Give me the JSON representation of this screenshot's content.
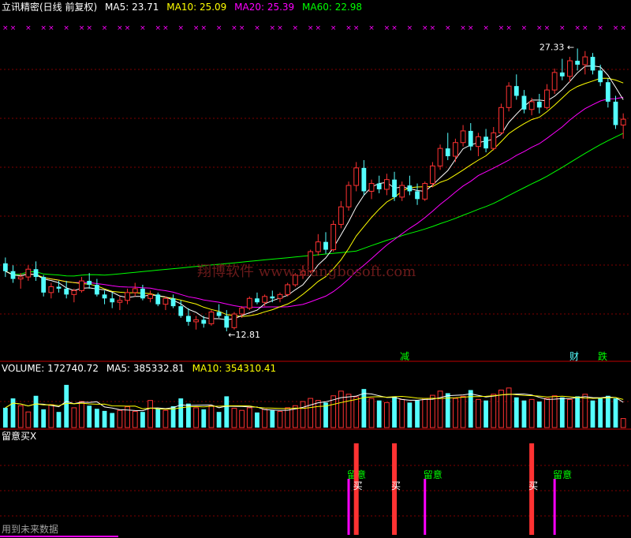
{
  "colors": {
    "background": "#000000",
    "up": "#ff3232",
    "down": "#54ffff",
    "ma5": "#ffffff",
    "ma10": "#ffff00",
    "ma20": "#ff00ff",
    "ma60": "#00ff00",
    "grid": "#800000",
    "marker": "#ff00ff"
  },
  "main_header": {
    "title": "立讯精密(日线 前复权)",
    "ma5": "MA5: 23.71",
    "ma10": "MA10: 25.09",
    "ma20": "MA20: 25.39",
    "ma60": "MA60: 22.98"
  },
  "volume_header": {
    "volume": "VOLUME: 172740.72",
    "ma5": "MA5: 385332.81",
    "ma10": "MA10: 354310.41"
  },
  "indicator_header": {
    "title": "留意买X"
  },
  "footer_note": "用到未来数据",
  "watermark": "翔博软件 www.xiangbosoft.com",
  "tags": {
    "jian": "减",
    "cai": "财",
    "die": "跌"
  },
  "signal_labels": {
    "watch": "留意",
    "buy": "买"
  },
  "chart_data": [
    {
      "type": "candlestick",
      "title": "立讯精密(日线 前复权)",
      "annotations": [
        {
          "text": "27.33",
          "kind": "high"
        },
        {
          "text": "12.81",
          "kind": "low"
        }
      ],
      "ohlc": [
        [
          16.3,
          16.6,
          15.6,
          15.9
        ],
        [
          15.9,
          16.2,
          15.3,
          15.5
        ],
        [
          15.5,
          15.8,
          15.0,
          15.6
        ],
        [
          15.6,
          16.2,
          15.4,
          16.0
        ],
        [
          16.0,
          16.4,
          15.4,
          15.6
        ],
        [
          15.6,
          15.7,
          14.6,
          14.8
        ],
        [
          14.8,
          15.3,
          14.5,
          15.1
        ],
        [
          15.1,
          15.4,
          14.8,
          15.0
        ],
        [
          15.0,
          15.4,
          14.5,
          14.7
        ],
        [
          14.7,
          15.0,
          14.3,
          14.9
        ],
        [
          14.9,
          15.6,
          14.8,
          15.4
        ],
        [
          15.4,
          15.8,
          15.0,
          15.2
        ],
        [
          15.2,
          15.5,
          14.6,
          14.7
        ],
        [
          14.7,
          14.9,
          14.2,
          14.5
        ],
        [
          14.5,
          14.8,
          14.0,
          14.3
        ],
        [
          14.3,
          14.6,
          13.9,
          14.4
        ],
        [
          14.4,
          15.0,
          14.2,
          14.8
        ],
        [
          14.8,
          15.3,
          14.6,
          15.0
        ],
        [
          15.0,
          15.2,
          14.4,
          14.5
        ],
        [
          14.5,
          14.9,
          14.3,
          14.7
        ],
        [
          14.7,
          14.8,
          14.1,
          14.2
        ],
        [
          14.2,
          14.6,
          13.9,
          14.5
        ],
        [
          14.5,
          14.7,
          14.0,
          14.1
        ],
        [
          14.1,
          14.4,
          13.5,
          13.6
        ],
        [
          13.6,
          14.0,
          13.1,
          13.3
        ],
        [
          13.3,
          13.6,
          12.9,
          13.4
        ],
        [
          13.4,
          13.6,
          13.0,
          13.2
        ],
        [
          13.2,
          13.9,
          13.1,
          13.8
        ],
        [
          13.8,
          14.2,
          13.5,
          13.6
        ],
        [
          13.6,
          13.9,
          12.81,
          13.0
        ],
        [
          13.0,
          13.8,
          12.9,
          13.7
        ],
        [
          13.7,
          14.1,
          13.5,
          14.0
        ],
        [
          14.0,
          14.6,
          13.9,
          14.5
        ],
        [
          14.5,
          14.8,
          14.2,
          14.3
        ],
        [
          14.3,
          14.7,
          14.1,
          14.6
        ],
        [
          14.6,
          14.9,
          14.3,
          14.5
        ],
        [
          14.5,
          14.8,
          14.3,
          14.7
        ],
        [
          14.7,
          15.3,
          14.6,
          15.2
        ],
        [
          15.2,
          15.8,
          15.1,
          15.7
        ],
        [
          15.7,
          16.2,
          15.5,
          15.9
        ],
        [
          15.9,
          17.0,
          15.8,
          16.9
        ],
        [
          16.9,
          17.8,
          16.7,
          17.4
        ],
        [
          17.4,
          17.9,
          16.8,
          17.0
        ],
        [
          17.0,
          18.5,
          16.9,
          18.3
        ],
        [
          18.3,
          19.5,
          18.1,
          19.2
        ],
        [
          19.2,
          20.5,
          19.0,
          20.3
        ],
        [
          20.3,
          21.5,
          20.0,
          21.2
        ],
        [
          21.2,
          21.6,
          19.8,
          20.0
        ],
        [
          20.0,
          20.6,
          19.6,
          20.4
        ],
        [
          20.4,
          20.8,
          19.9,
          20.1
        ],
        [
          20.1,
          20.9,
          19.8,
          20.6
        ],
        [
          20.6,
          21.0,
          19.5,
          19.7
        ],
        [
          19.7,
          20.5,
          19.5,
          20.3
        ],
        [
          20.3,
          20.8,
          19.8,
          20.0
        ],
        [
          20.0,
          20.4,
          19.3,
          19.6
        ],
        [
          19.6,
          20.5,
          19.5,
          20.4
        ],
        [
          20.4,
          21.5,
          20.2,
          21.3
        ],
        [
          21.3,
          22.4,
          21.1,
          22.2
        ],
        [
          22.2,
          23.0,
          21.6,
          21.8
        ],
        [
          21.8,
          22.7,
          21.5,
          22.5
        ],
        [
          22.5,
          23.4,
          22.3,
          23.1
        ],
        [
          23.1,
          23.5,
          22.1,
          22.3
        ],
        [
          22.3,
          23.0,
          21.8,
          22.8
        ],
        [
          22.8,
          23.2,
          22.0,
          22.2
        ],
        [
          22.2,
          23.3,
          22.1,
          23.0
        ],
        [
          23.0,
          24.5,
          22.9,
          24.3
        ],
        [
          24.3,
          25.6,
          24.1,
          25.4
        ],
        [
          25.4,
          26.0,
          24.7,
          24.9
        ],
        [
          24.9,
          25.2,
          24.0,
          24.2
        ],
        [
          24.2,
          24.8,
          23.9,
          24.6
        ],
        [
          24.6,
          25.0,
          24.0,
          24.3
        ],
        [
          24.3,
          25.5,
          24.2,
          25.2
        ],
        [
          25.2,
          26.3,
          25.0,
          26.1
        ],
        [
          26.1,
          26.8,
          25.7,
          25.9
        ],
        [
          25.9,
          26.9,
          25.6,
          26.7
        ],
        [
          26.7,
          27.33,
          26.2,
          26.5
        ],
        [
          26.5,
          27.2,
          26.0,
          26.9
        ],
        [
          26.9,
          27.1,
          26.0,
          26.2
        ],
        [
          26.2,
          26.5,
          25.4,
          25.6
        ],
        [
          25.6,
          25.8,
          24.3,
          24.6
        ],
        [
          24.6,
          24.9,
          23.2,
          23.4
        ],
        [
          23.4,
          24.0,
          22.7,
          23.7
        ]
      ],
      "ma60_end": 22.98,
      "ylim": [
        12.0,
        28.2
      ]
    },
    {
      "type": "bar",
      "title": "VOLUME",
      "ylim": [
        0,
        1000000
      ],
      "values": [
        380000,
        560000,
        420000,
        300000,
        610000,
        350000,
        440000,
        300000,
        820000,
        380000,
        500000,
        420000,
        360000,
        320000,
        280000,
        330000,
        400000,
        310000,
        300000,
        520000,
        360000,
        330000,
        410000,
        560000,
        460000,
        380000,
        350000,
        420000,
        300000,
        600000,
        370000,
        330000,
        380000,
        290000,
        350000,
        330000,
        310000,
        380000,
        420000,
        500000,
        560000,
        520000,
        480000,
        610000,
        700000,
        640000,
        590000,
        740000,
        560000,
        520000,
        480000,
        600000,
        540000,
        480000,
        520000,
        560000,
        620000,
        700000,
        660000,
        560000,
        600000,
        720000,
        540000,
        520000,
        640000,
        720000,
        760000,
        580000,
        520000,
        540000,
        500000,
        560000,
        610000,
        580000,
        540000,
        600000,
        640000,
        520000,
        560000,
        610000,
        560000,
        172740
      ]
    },
    {
      "type": "signal",
      "title": "留意买X",
      "signals": [
        {
          "label": "留意",
          "kind": "watch"
        },
        {
          "label": "买",
          "kind": "buy"
        },
        {
          "label": "买",
          "kind": "buy"
        },
        {
          "label": "留意",
          "kind": "watch"
        },
        {
          "label": "买",
          "kind": "buy"
        },
        {
          "label": "留意",
          "kind": "watch"
        }
      ]
    }
  ]
}
